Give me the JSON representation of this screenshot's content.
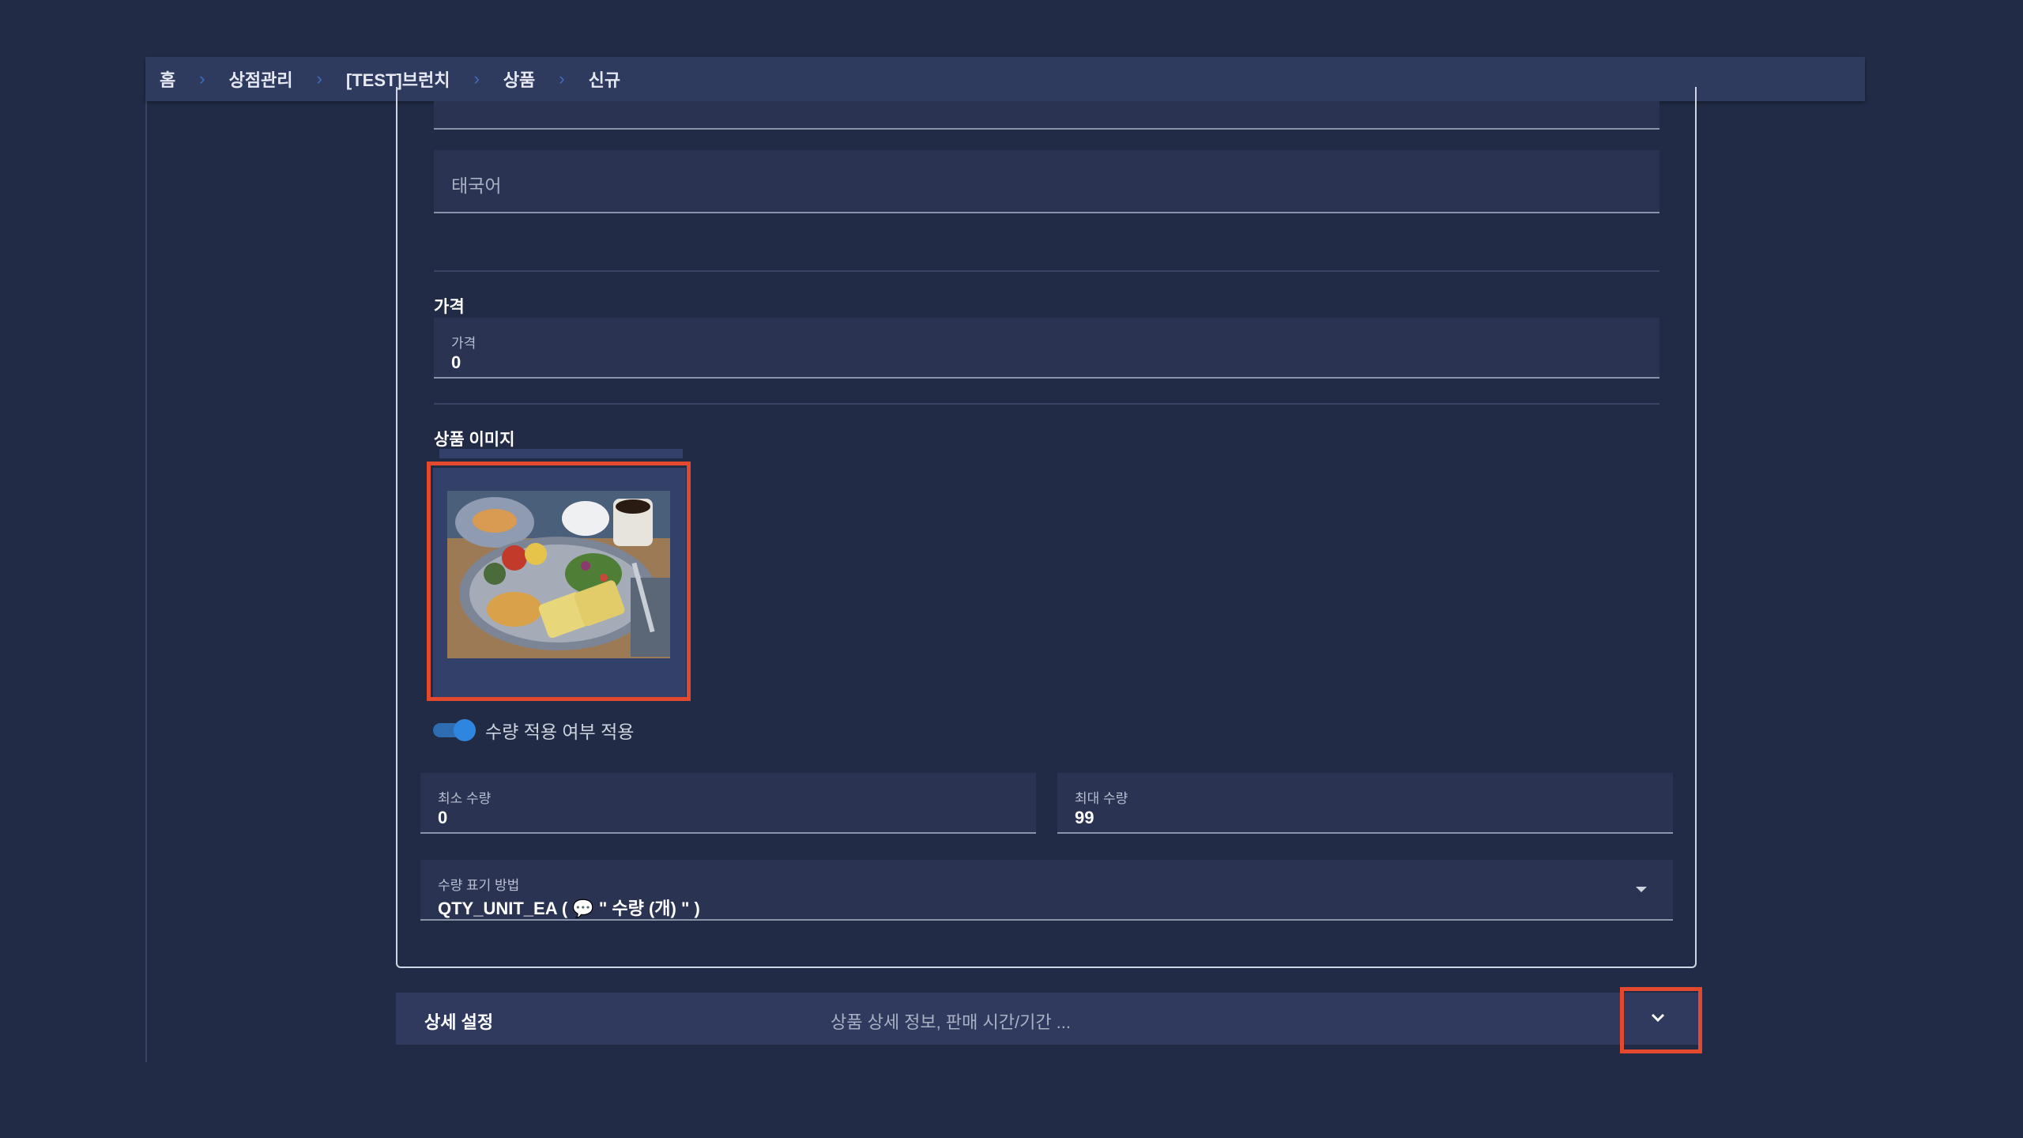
{
  "breadcrumb": {
    "items": [
      "홈",
      "상점관리",
      "[TEST]브런치",
      "상품",
      "신규"
    ]
  },
  "form": {
    "thai_field": {
      "placeholder": "태국어"
    },
    "price_section": {
      "title": "가격",
      "field_label": "가격",
      "field_value": "0"
    },
    "image_section": {
      "title": "상품 이미지"
    },
    "quantity_toggle": {
      "label": "수량 적용 여부 적용",
      "on": true
    },
    "min_qty": {
      "label": "최소 수량",
      "value": "0"
    },
    "max_qty": {
      "label": "최대 수량",
      "value": "99"
    },
    "qty_display": {
      "label": "수량 표기 방법",
      "value": "QTY_UNIT_EA ( 💬 \" 수량 (개) \" )"
    }
  },
  "detail_settings": {
    "title": "상세 설정",
    "summary": "상품 상세 정보, 판매 시간/기간 ..."
  },
  "colors": {
    "background": "#222b45",
    "highlight": "#e2492d",
    "toggle": "#2f86e0"
  },
  "icons": {
    "breadcrumb_separator": "chevron-right-icon",
    "select_arrow": "caret-down-icon",
    "expand": "chevron-down-icon"
  }
}
